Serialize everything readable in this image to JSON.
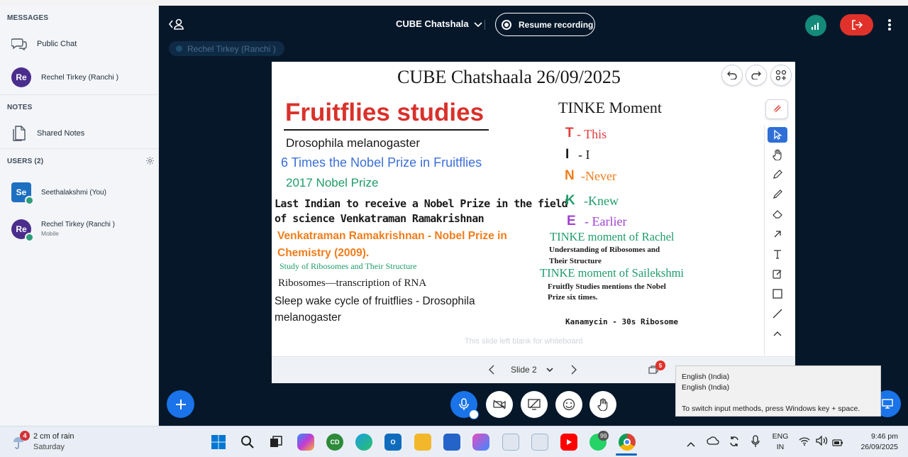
{
  "sidebar": {
    "messages_heading": "MESSAGES",
    "public_chat": "Public Chat",
    "chat_user": {
      "initials": "Re",
      "name": "Rechel Tirkey (Ranchi )"
    },
    "notes_heading": "NOTES",
    "shared_notes": "Shared Notes",
    "users_heading": "USERS (2)",
    "users": [
      {
        "initials": "Se",
        "name": "Seethalakshmi (You)",
        "sub": ""
      },
      {
        "initials": "Re",
        "name": "Rechel Tirkey (Ranchi )",
        "sub": "Mobile"
      }
    ]
  },
  "topbar": {
    "title": "CUBE Chatshala",
    "recording_label": "Resume recording",
    "talking_indicator": "Rechel Tirkey (Ranchi )"
  },
  "slide": {
    "title": "CUBE Chatshaala 26/09/2025",
    "left": {
      "heading": "Fruitflies studies",
      "line1": "Drosophila melanogaster",
      "line2": "6 Times the Nobel Prize in Fruitflies",
      "line3": "2017 Nobel Prize",
      "line4a": "Last Indian to receive a Nobel Prize in the field",
      "line4b": "of science Venkatraman Ramakrishnan",
      "line5a": "Venkatraman Ramakrishnan - Nobel Prize in",
      "line5b": "Chemistry (2009).",
      "line6": "Study of Ribosomes and Their Structure",
      "line7": "Ribosomes—transcription of RNA",
      "line8a": "Sleep wake cycle of fruitflies - Drosophila",
      "line8b": "melanogaster"
    },
    "right": {
      "heading": "TINKE Moment",
      "t_letter": "T",
      "t_word": "- This",
      "i_letter": "I",
      "i_word": "- I",
      "n_letter": "N",
      "n_word": "-Never",
      "k_letter": "K",
      "k_word": "-Knew",
      "e_letter": "E",
      "e_word": "- Earlier",
      "rachel_heading": "TINKE moment of Rachel",
      "rachel_text1": "Understanding of Ribosomes and",
      "rachel_text2": "Their Structure",
      "saileksh_heading": "TINKE moment of Sailekshmi",
      "saileksh_text1": "Fruitfly Studies mentions the Nobel",
      "saileksh_text2": "Prize six times.",
      "footnote": "Kanamycin  - 30s  Ribosome"
    },
    "blank_note": "This slide left blank for whiteboard",
    "footer_slide_label": "Slide 2",
    "badge_count": "5"
  },
  "tooltip": {
    "line1": "English (India)",
    "line2": "English (India)",
    "line3": "To switch input methods, press Windows key + space."
  },
  "taskbar": {
    "weather_badge": "4",
    "weather_title": "2 cm of rain",
    "weather_sub": "Saturday",
    "whatsapp_badge": "99",
    "lang_top": "ENG",
    "lang_bottom": "IN",
    "time": "9:46 pm",
    "date": "26/09/2025"
  },
  "colors": {
    "sidebar_bg": "#f3f5f8",
    "main_bg": "#06172a",
    "accent_blue": "#1a73e8",
    "leave_red": "#e0322a",
    "signal_teal": "#138a7a",
    "heading_red": "#d9312b",
    "text_blue": "#3b6fd6",
    "text_green": "#1f9c6b",
    "text_orange": "#f07d1a",
    "text_purple": "#a13fd1"
  }
}
